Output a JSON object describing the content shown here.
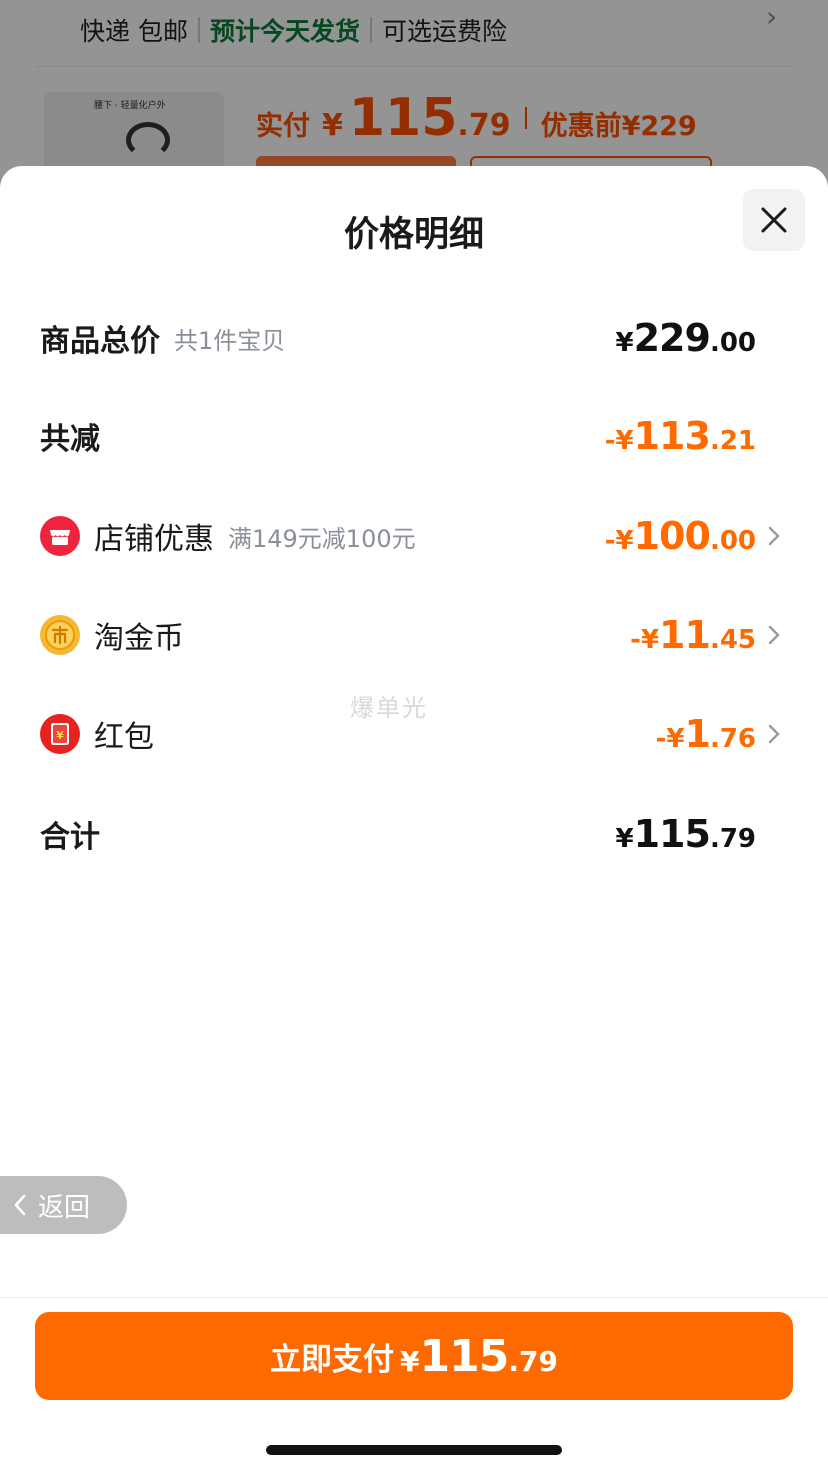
{
  "background": {
    "shipping": {
      "item1": "快递 包邮",
      "item2": "预计今天发货",
      "item3": "可选运费险"
    },
    "thumbnail_text": "腰下 · 轻量化户外",
    "price": {
      "label": "实付",
      "currency": "¥",
      "integer": "115",
      "decimal": ".79",
      "before_label": "优惠前",
      "before_value": "¥229"
    }
  },
  "sheet": {
    "title": "价格明细",
    "rows": [
      {
        "label": "商品总价",
        "sub": "共1件宝贝",
        "sign": "",
        "currency": "¥",
        "integer": "229",
        "decimal": ".00",
        "color": "dark",
        "chevron": false
      },
      {
        "label": "共减",
        "sub": "",
        "sign": "-",
        "currency": "¥",
        "integer": "113",
        "decimal": ".21",
        "color": "orange",
        "chevron": false
      },
      {
        "label": "店铺优惠",
        "sub": "满149元减100元",
        "icon": "shop-icon",
        "sign": "-",
        "currency": "¥",
        "integer": "100",
        "decimal": ".00",
        "color": "orange",
        "chevron": true
      },
      {
        "label": "淘金币",
        "sub": "",
        "icon": "coin-icon",
        "sign": "-",
        "currency": "¥",
        "integer": "11",
        "decimal": ".45",
        "color": "orange",
        "chevron": true
      },
      {
        "label": "红包",
        "sub": "",
        "icon": "red-envelope-icon",
        "sign": "-",
        "currency": "¥",
        "integer": "1",
        "decimal": ".76",
        "color": "orange",
        "chevron": true
      },
      {
        "label": "合计",
        "sub": "",
        "sign": "",
        "currency": "¥",
        "integer": "115",
        "decimal": ".79",
        "color": "dark",
        "chevron": false
      }
    ],
    "watermark": "爆单光",
    "back_label": "返回",
    "pay_button": {
      "label": "立即支付",
      "currency": "¥",
      "integer": "115",
      "decimal": ".79"
    }
  },
  "colors": {
    "accent": "#ff6a00",
    "green": "#0b7a3b",
    "shop_red": "#f0243f",
    "coin_gold": "#f5b82e"
  }
}
